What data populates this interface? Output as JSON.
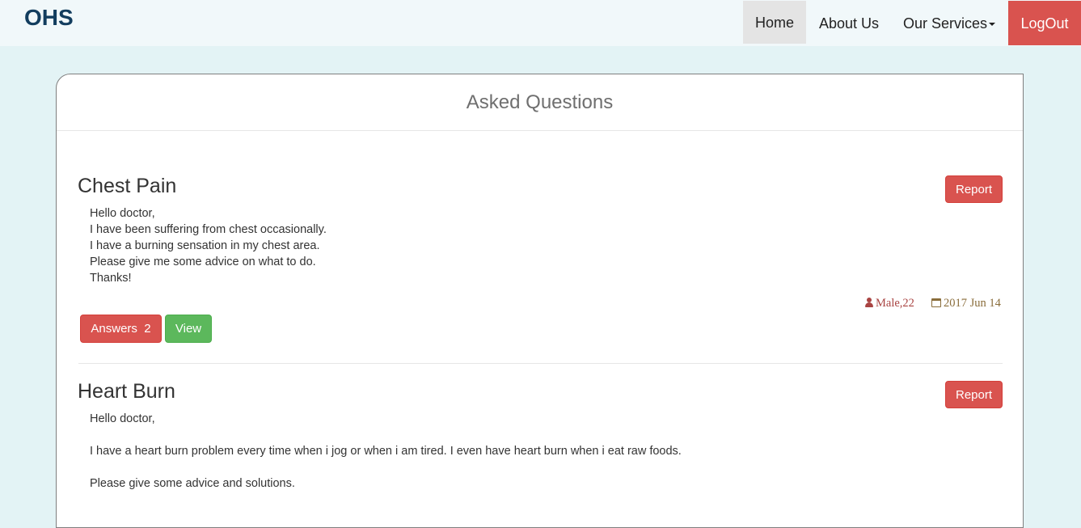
{
  "navbar": {
    "brand": "OHS",
    "home": "Home",
    "about": "About Us",
    "services": "Our Services",
    "logout": "LogOut"
  },
  "panel": {
    "title": "Asked Questions"
  },
  "questions": [
    {
      "title": "Chest Pain",
      "report_label": "Report",
      "body": [
        "Hello doctor,",
        "I have been suffering from chest occasionally.",
        "I have a burning sensation in my chest area.",
        "Please give me some advice on what to do.",
        "Thanks!"
      ],
      "user": "Male,22",
      "date": "2017 Jun 14",
      "answers_label": "Answers",
      "answers_count": "2",
      "view_label": "View"
    },
    {
      "title": "Heart Burn",
      "report_label": "Report",
      "body": [
        "Hello doctor,",
        "",
        "I have a heart burn problem every time when i jog or when i am tired. I even have heart burn when i eat raw foods.",
        "",
        "Please give some advice and solutions."
      ]
    }
  ],
  "colors": {
    "background": "#e3f3f5",
    "navbar": "#f1f8fa",
    "brand": "#123d5e",
    "danger": "#d9534f",
    "success": "#5cb85c"
  },
  "icons": {
    "user": "user-icon",
    "date": "calendar-icon",
    "dropdown": "caret-down-icon"
  }
}
